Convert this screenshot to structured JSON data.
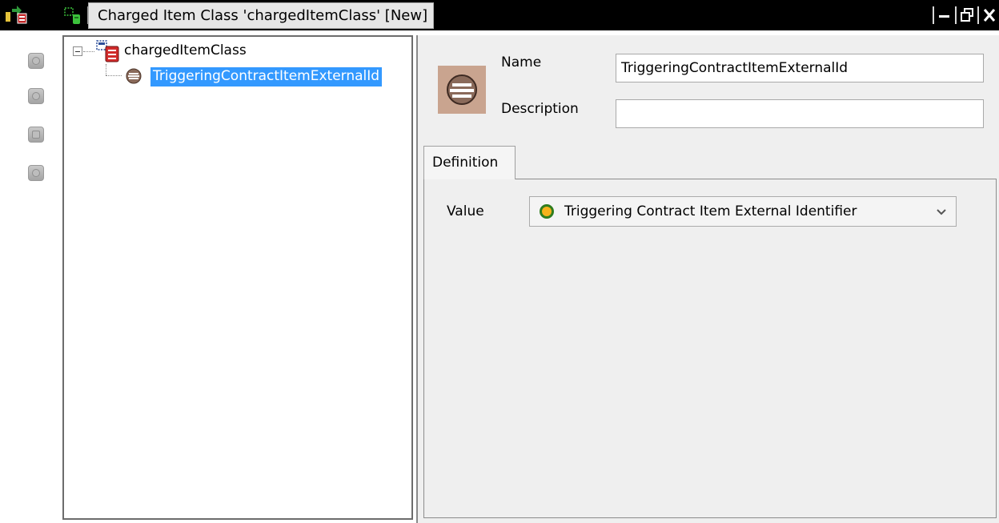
{
  "window": {
    "title": "Charged Item Class 'chargedItemClass' [New]",
    "controls": {
      "minimize": "minimize",
      "restore": "restore",
      "close": "close"
    }
  },
  "toolbar": {
    "buttons": [
      {
        "icon": "field-icon"
      },
      {
        "icon": "formula-icon"
      },
      {
        "icon": "table-icon"
      },
      {
        "icon": "globe-icon"
      }
    ]
  },
  "tree": {
    "root": {
      "label": "chargedItemClass",
      "icon": "charged-item-class-icon",
      "expanded": true
    },
    "children": [
      {
        "label": "TriggeringContractItemExternalId",
        "icon": "field-icon",
        "selected": true
      }
    ]
  },
  "detail": {
    "name_label": "Name",
    "name_value": "TriggeringContractItemExternalId",
    "description_label": "Description",
    "description_value": "",
    "tabs": [
      {
        "label": "Definition",
        "active": true
      }
    ],
    "definition": {
      "value_label": "Value",
      "value_selected": "Triggering Contract Item External Identifier"
    }
  },
  "colors": {
    "selection": "#3399ff",
    "titlebar": "#000000",
    "panel_bg": "#efefef",
    "value_dot_fill": "#f6b21b",
    "value_dot_ring": "#2f7d1e"
  }
}
